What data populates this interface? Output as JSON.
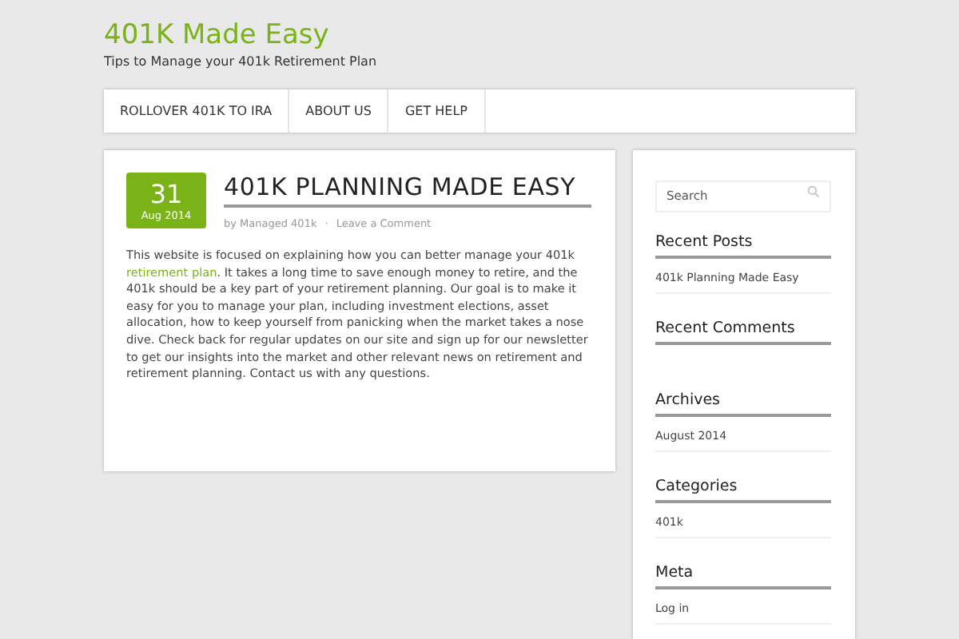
{
  "site": {
    "title": "401K Made Easy",
    "tagline": "Tips to Manage your 401k Retirement Plan"
  },
  "nav": [
    "ROLLOVER 401K TO IRA",
    "ABOUT US",
    "GET HELP"
  ],
  "post": {
    "day": "31",
    "month": "Aug 2014",
    "title": "401K PLANNING MADE EASY",
    "author": "by Managed 401k",
    "separator": "·",
    "comments": "Leave a Comment",
    "body": [
      {
        "kind": "text",
        "text": "This website is focused on explaining how you can better manage your 401k "
      },
      {
        "kind": "link",
        "text": "retirement plan"
      },
      {
        "kind": "text",
        "text": ". It takes a long time to save enough money to retire, and the 401k should be a key part of your retirement planning. Our goal is to make it easy for you to manage your plan, including investment elections, asset allocation, how to keep yourself from panicking when the market takes a nose dive. Check back for regular updates on our site and sign up for our newsletter to get our insights into the market and other relevant news on retirement and retirement planning. Contact us with any questions."
      }
    ]
  },
  "sidebar": {
    "search": {
      "placeholder": "Search"
    },
    "widgets": [
      {
        "title": "Recent Posts",
        "items": [
          "401k Planning Made Easy"
        ]
      },
      {
        "title": "Recent Comments"
      },
      {
        "title": "Archives",
        "items": [
          "August 2014"
        ]
      },
      {
        "title": "Categories",
        "items": [
          "401k"
        ]
      },
      {
        "title": "Meta",
        "items": [
          "Log in"
        ]
      }
    ]
  }
}
